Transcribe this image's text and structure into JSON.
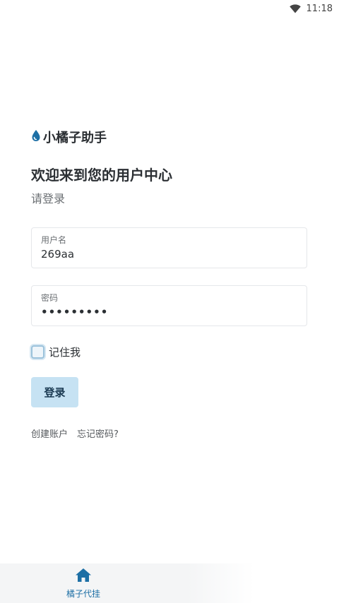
{
  "status_bar": {
    "time": "11:18",
    "icons": [
      "wifi-icon"
    ]
  },
  "brand": {
    "name": "小橘子助手",
    "icon": "water-drop-icon",
    "icon_color": "#1d6fa5"
  },
  "welcome": {
    "title": "欢迎来到您的用户中心",
    "subtitle": "请登录"
  },
  "form": {
    "username": {
      "label": "用户名",
      "value": "269aa"
    },
    "password": {
      "label": "密码",
      "value": "•••••••••"
    },
    "remember": {
      "label": "记住我",
      "checked": false
    },
    "login_button": "登录"
  },
  "links": {
    "create_account": "创建账户",
    "forgot_password": "忘记密码?"
  },
  "bottom_nav": {
    "items": [
      {
        "label": "橘子代挂",
        "icon": "home-icon",
        "active": true
      }
    ]
  },
  "colors": {
    "accent": "#1d6fa5",
    "button_bg": "#c6e2f3"
  }
}
